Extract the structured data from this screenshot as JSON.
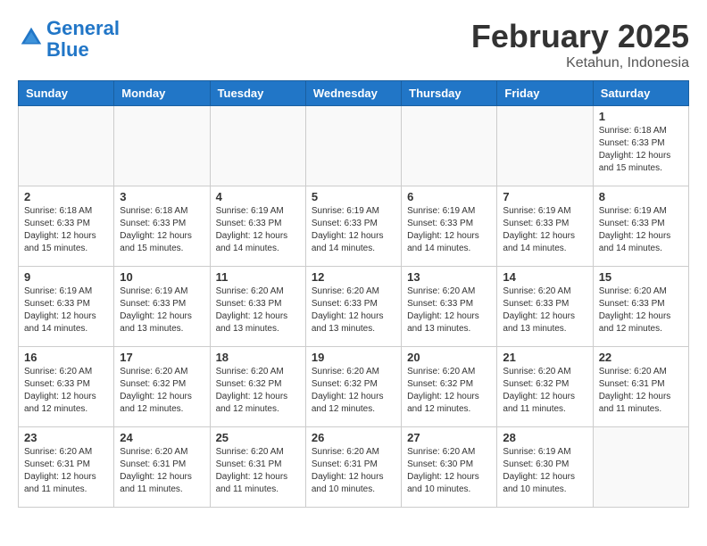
{
  "logo": {
    "line1": "General",
    "line2": "Blue"
  },
  "title": "February 2025",
  "location": "Ketahun, Indonesia",
  "weekdays": [
    "Sunday",
    "Monday",
    "Tuesday",
    "Wednesday",
    "Thursday",
    "Friday",
    "Saturday"
  ],
  "weeks": [
    [
      {
        "day": "",
        "info": ""
      },
      {
        "day": "",
        "info": ""
      },
      {
        "day": "",
        "info": ""
      },
      {
        "day": "",
        "info": ""
      },
      {
        "day": "",
        "info": ""
      },
      {
        "day": "",
        "info": ""
      },
      {
        "day": "1",
        "info": "Sunrise: 6:18 AM\nSunset: 6:33 PM\nDaylight: 12 hours\nand 15 minutes."
      }
    ],
    [
      {
        "day": "2",
        "info": "Sunrise: 6:18 AM\nSunset: 6:33 PM\nDaylight: 12 hours\nand 15 minutes."
      },
      {
        "day": "3",
        "info": "Sunrise: 6:18 AM\nSunset: 6:33 PM\nDaylight: 12 hours\nand 15 minutes."
      },
      {
        "day": "4",
        "info": "Sunrise: 6:19 AM\nSunset: 6:33 PM\nDaylight: 12 hours\nand 14 minutes."
      },
      {
        "day": "5",
        "info": "Sunrise: 6:19 AM\nSunset: 6:33 PM\nDaylight: 12 hours\nand 14 minutes."
      },
      {
        "day": "6",
        "info": "Sunrise: 6:19 AM\nSunset: 6:33 PM\nDaylight: 12 hours\nand 14 minutes."
      },
      {
        "day": "7",
        "info": "Sunrise: 6:19 AM\nSunset: 6:33 PM\nDaylight: 12 hours\nand 14 minutes."
      },
      {
        "day": "8",
        "info": "Sunrise: 6:19 AM\nSunset: 6:33 PM\nDaylight: 12 hours\nand 14 minutes."
      }
    ],
    [
      {
        "day": "9",
        "info": "Sunrise: 6:19 AM\nSunset: 6:33 PM\nDaylight: 12 hours\nand 14 minutes."
      },
      {
        "day": "10",
        "info": "Sunrise: 6:19 AM\nSunset: 6:33 PM\nDaylight: 12 hours\nand 13 minutes."
      },
      {
        "day": "11",
        "info": "Sunrise: 6:20 AM\nSunset: 6:33 PM\nDaylight: 12 hours\nand 13 minutes."
      },
      {
        "day": "12",
        "info": "Sunrise: 6:20 AM\nSunset: 6:33 PM\nDaylight: 12 hours\nand 13 minutes."
      },
      {
        "day": "13",
        "info": "Sunrise: 6:20 AM\nSunset: 6:33 PM\nDaylight: 12 hours\nand 13 minutes."
      },
      {
        "day": "14",
        "info": "Sunrise: 6:20 AM\nSunset: 6:33 PM\nDaylight: 12 hours\nand 13 minutes."
      },
      {
        "day": "15",
        "info": "Sunrise: 6:20 AM\nSunset: 6:33 PM\nDaylight: 12 hours\nand 12 minutes."
      }
    ],
    [
      {
        "day": "16",
        "info": "Sunrise: 6:20 AM\nSunset: 6:33 PM\nDaylight: 12 hours\nand 12 minutes."
      },
      {
        "day": "17",
        "info": "Sunrise: 6:20 AM\nSunset: 6:32 PM\nDaylight: 12 hours\nand 12 minutes."
      },
      {
        "day": "18",
        "info": "Sunrise: 6:20 AM\nSunset: 6:32 PM\nDaylight: 12 hours\nand 12 minutes."
      },
      {
        "day": "19",
        "info": "Sunrise: 6:20 AM\nSunset: 6:32 PM\nDaylight: 12 hours\nand 12 minutes."
      },
      {
        "day": "20",
        "info": "Sunrise: 6:20 AM\nSunset: 6:32 PM\nDaylight: 12 hours\nand 12 minutes."
      },
      {
        "day": "21",
        "info": "Sunrise: 6:20 AM\nSunset: 6:32 PM\nDaylight: 12 hours\nand 11 minutes."
      },
      {
        "day": "22",
        "info": "Sunrise: 6:20 AM\nSunset: 6:31 PM\nDaylight: 12 hours\nand 11 minutes."
      }
    ],
    [
      {
        "day": "23",
        "info": "Sunrise: 6:20 AM\nSunset: 6:31 PM\nDaylight: 12 hours\nand 11 minutes."
      },
      {
        "day": "24",
        "info": "Sunrise: 6:20 AM\nSunset: 6:31 PM\nDaylight: 12 hours\nand 11 minutes."
      },
      {
        "day": "25",
        "info": "Sunrise: 6:20 AM\nSunset: 6:31 PM\nDaylight: 12 hours\nand 11 minutes."
      },
      {
        "day": "26",
        "info": "Sunrise: 6:20 AM\nSunset: 6:31 PM\nDaylight: 12 hours\nand 10 minutes."
      },
      {
        "day": "27",
        "info": "Sunrise: 6:20 AM\nSunset: 6:30 PM\nDaylight: 12 hours\nand 10 minutes."
      },
      {
        "day": "28",
        "info": "Sunrise: 6:19 AM\nSunset: 6:30 PM\nDaylight: 12 hours\nand 10 minutes."
      },
      {
        "day": "",
        "info": ""
      }
    ]
  ]
}
